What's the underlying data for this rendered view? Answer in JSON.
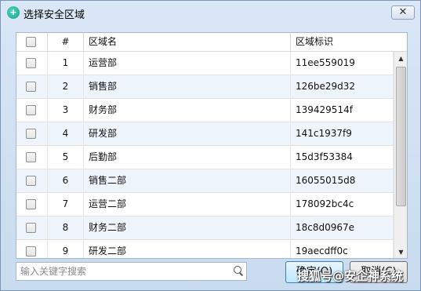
{
  "dialog": {
    "title": "选择安全区域",
    "close_label": "✕"
  },
  "table": {
    "headers": {
      "num": "#",
      "name": "区域名",
      "id": "区域标识"
    },
    "rows": [
      {
        "num": "1",
        "name": "运营部",
        "id": "11ee559019"
      },
      {
        "num": "2",
        "name": "销售部",
        "id": "126be29d32"
      },
      {
        "num": "3",
        "name": "财务部",
        "id": "139429514f"
      },
      {
        "num": "4",
        "name": "研发部",
        "id": "141c1937f9"
      },
      {
        "num": "5",
        "name": "后勤部",
        "id": "15d3f53384"
      },
      {
        "num": "6",
        "name": "销售二部",
        "id": "16055015d8"
      },
      {
        "num": "7",
        "name": "运营二部",
        "id": "178092bc4c"
      },
      {
        "num": "8",
        "name": "财务二部",
        "id": "18c8d0967e"
      },
      {
        "num": "9",
        "name": "研发二部",
        "id": "19aecdff0c"
      }
    ],
    "row_colors": {
      "odd": "#ffffff",
      "even": "#eef4fc"
    }
  },
  "search": {
    "placeholder": "输入关键字搜索",
    "value": ""
  },
  "buttons": {
    "ok_label": "确定(O)",
    "cancel_label": "取消(C)"
  },
  "watermark": "搜狐号@安企神系统"
}
